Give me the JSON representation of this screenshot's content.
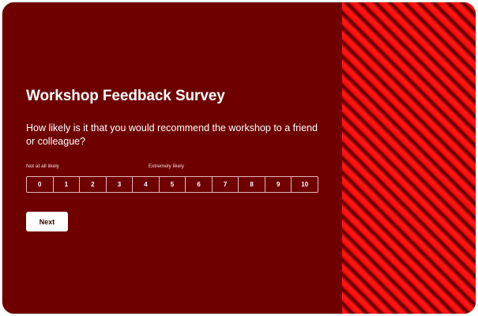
{
  "survey": {
    "title": "Workshop Feedback Survey",
    "question": "How likely is it that you would recommend the workshop to a friend or colleague?",
    "scale": {
      "min_label": "Not at all likely",
      "max_label": "Extremely likely",
      "options": [
        "0",
        "1",
        "2",
        "3",
        "4",
        "5",
        "6",
        "7",
        "8",
        "9",
        "10"
      ]
    },
    "next_label": "Next"
  },
  "colors": {
    "background": "#6e0000",
    "stripe_bright": "#ff0a0a",
    "stripe_dark": "#4a0000",
    "text": "#ffffff"
  }
}
